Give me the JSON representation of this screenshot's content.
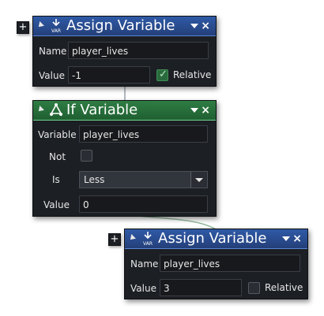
{
  "blocks": [
    {
      "title": "Assign Variable",
      "icon_name": "var-download-icon",
      "icon_text": "VAR",
      "name_label": "Name",
      "name_value": "player_lives",
      "value_label": "Value",
      "value_value": "-1",
      "relative_label": "Relative",
      "relative_checked": true
    },
    {
      "title": "If Variable",
      "icon_name": "if-branch-icon",
      "variable_label": "Variable",
      "variable_value": "player_lives",
      "not_label": "Not",
      "not_checked": false,
      "is_label": "Is",
      "is_value": "Less",
      "value_label": "Value",
      "value_value": "0"
    },
    {
      "title": "Assign Variable",
      "icon_name": "var-download-icon",
      "icon_text": "VAR",
      "name_label": "Name",
      "name_value": "player_lives",
      "value_label": "Value",
      "value_value": "3",
      "relative_label": "Relative",
      "relative_checked": false
    }
  ],
  "colors": {
    "assign_header": "#2f5aa7",
    "if_header": "#2f7d44",
    "panel_bg": "#1c1f24",
    "connector": "#9aa0a8"
  }
}
